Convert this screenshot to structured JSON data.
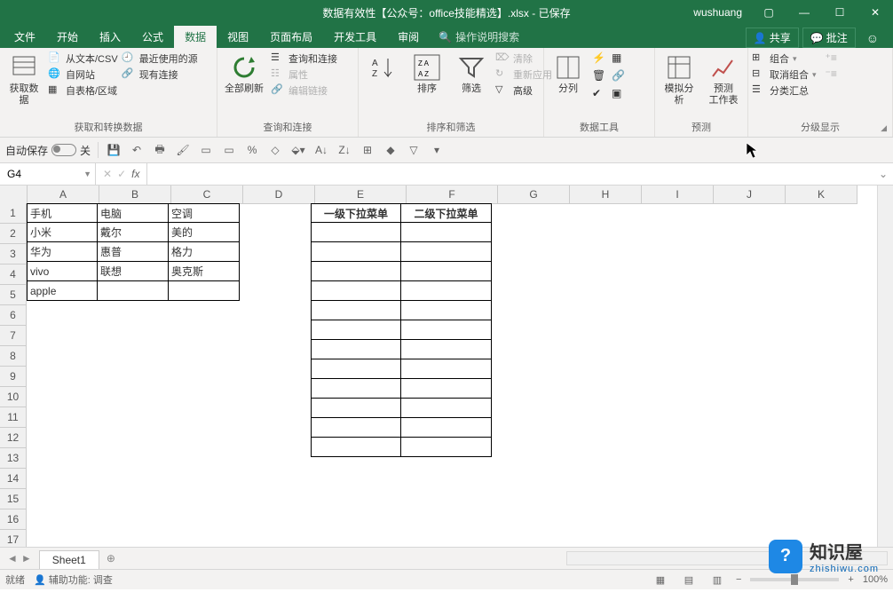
{
  "title": {
    "doc": "数据有效性【公众号：office技能精选】.xlsx",
    "saved": "已保存",
    "user": "wushuang"
  },
  "tabs": {
    "file": "文件",
    "home": "开始",
    "insert": "插入",
    "formulas": "公式",
    "data": "数据",
    "view": "视图",
    "layout": "页面布局",
    "dev": "开发工具",
    "review": "审阅",
    "tellme": "操作说明搜索",
    "share": "共享",
    "comment": "批注"
  },
  "ribbon": {
    "g1": {
      "btn": "获取数\n据",
      "r1": "从文本/CSV",
      "r2": "自网站",
      "r3": "自表格/区域",
      "r4": "最近使用的源",
      "r5": "现有连接",
      "label": "获取和转换数据"
    },
    "g2": {
      "btn": "全部刷新",
      "r1": "查询和连接",
      "r2": "属性",
      "r3": "编辑链接",
      "label": "查询和连接"
    },
    "g3": {
      "b1": "",
      "b2": "排序",
      "b3": "筛选",
      "r1": "清除",
      "r2": "重新应用",
      "r3": "高级",
      "label": "排序和筛选"
    },
    "g4": {
      "btn": "分列",
      "label": "数据工具"
    },
    "g5": {
      "b1": "模拟分析",
      "b2": "预测\n工作表",
      "label": "预测"
    },
    "g6": {
      "r1": "组合",
      "r2": "取消组合",
      "r3": "分类汇总",
      "label": "分级显示"
    }
  },
  "qat": {
    "autosave": "自动保存",
    "off": "关"
  },
  "namebox": "G4",
  "columns": [
    "A",
    "B",
    "C",
    "D",
    "E",
    "F",
    "G",
    "H",
    "I",
    "J",
    "K"
  ],
  "rows": [
    "1",
    "2",
    "3",
    "4",
    "5",
    "6",
    "7",
    "8",
    "9",
    "10",
    "11",
    "12",
    "13",
    "14",
    "15",
    "16",
    "17"
  ],
  "cells": {
    "A1": "手机",
    "B1": "电脑",
    "C1": "空调",
    "A2": "小米",
    "B2": "戴尔",
    "C2": "美的",
    "A3": "华为",
    "B3": "惠普",
    "C3": "格力",
    "A4": "vivo",
    "B4": "联想",
    "C4": "奥克斯",
    "A5": "apple",
    "E1": "一级下拉菜单",
    "F1": "二级下拉菜单"
  },
  "sheet": {
    "name": "Sheet1"
  },
  "status": {
    "ready": "就绪",
    "a11y": "辅助功能: 调查",
    "zoom": "100%"
  },
  "wm": {
    "l1": "知识屋",
    "l2": "zhishiwu.com"
  }
}
